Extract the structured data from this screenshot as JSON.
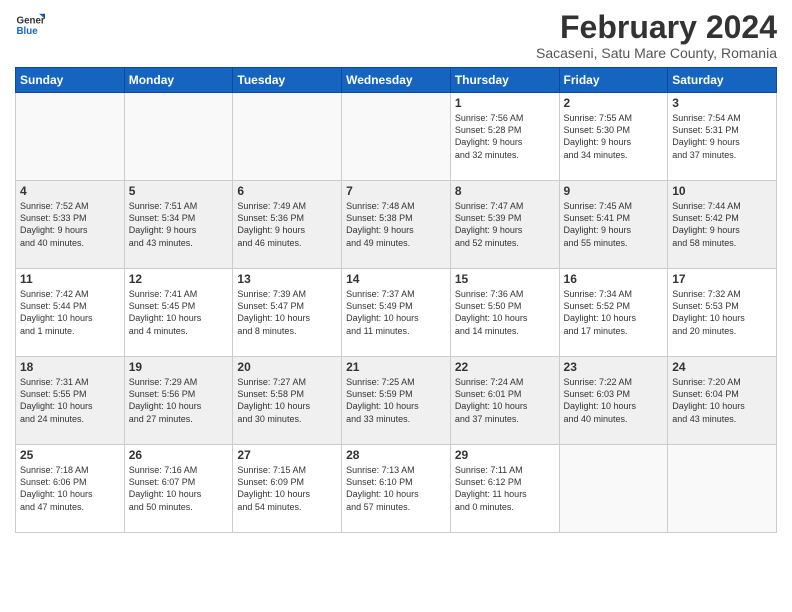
{
  "header": {
    "logo_general": "General",
    "logo_blue": "Blue",
    "month_title": "February 2024",
    "subtitle": "Sacaseni, Satu Mare County, Romania"
  },
  "days_of_week": [
    "Sunday",
    "Monday",
    "Tuesday",
    "Wednesday",
    "Thursday",
    "Friday",
    "Saturday"
  ],
  "weeks": [
    {
      "shaded": false,
      "days": [
        {
          "num": "",
          "info": ""
        },
        {
          "num": "",
          "info": ""
        },
        {
          "num": "",
          "info": ""
        },
        {
          "num": "",
          "info": ""
        },
        {
          "num": "1",
          "info": "Sunrise: 7:56 AM\nSunset: 5:28 PM\nDaylight: 9 hours\nand 32 minutes."
        },
        {
          "num": "2",
          "info": "Sunrise: 7:55 AM\nSunset: 5:30 PM\nDaylight: 9 hours\nand 34 minutes."
        },
        {
          "num": "3",
          "info": "Sunrise: 7:54 AM\nSunset: 5:31 PM\nDaylight: 9 hours\nand 37 minutes."
        }
      ]
    },
    {
      "shaded": true,
      "days": [
        {
          "num": "4",
          "info": "Sunrise: 7:52 AM\nSunset: 5:33 PM\nDaylight: 9 hours\nand 40 minutes."
        },
        {
          "num": "5",
          "info": "Sunrise: 7:51 AM\nSunset: 5:34 PM\nDaylight: 9 hours\nand 43 minutes."
        },
        {
          "num": "6",
          "info": "Sunrise: 7:49 AM\nSunset: 5:36 PM\nDaylight: 9 hours\nand 46 minutes."
        },
        {
          "num": "7",
          "info": "Sunrise: 7:48 AM\nSunset: 5:38 PM\nDaylight: 9 hours\nand 49 minutes."
        },
        {
          "num": "8",
          "info": "Sunrise: 7:47 AM\nSunset: 5:39 PM\nDaylight: 9 hours\nand 52 minutes."
        },
        {
          "num": "9",
          "info": "Sunrise: 7:45 AM\nSunset: 5:41 PM\nDaylight: 9 hours\nand 55 minutes."
        },
        {
          "num": "10",
          "info": "Sunrise: 7:44 AM\nSunset: 5:42 PM\nDaylight: 9 hours\nand 58 minutes."
        }
      ]
    },
    {
      "shaded": false,
      "days": [
        {
          "num": "11",
          "info": "Sunrise: 7:42 AM\nSunset: 5:44 PM\nDaylight: 10 hours\nand 1 minute."
        },
        {
          "num": "12",
          "info": "Sunrise: 7:41 AM\nSunset: 5:45 PM\nDaylight: 10 hours\nand 4 minutes."
        },
        {
          "num": "13",
          "info": "Sunrise: 7:39 AM\nSunset: 5:47 PM\nDaylight: 10 hours\nand 8 minutes."
        },
        {
          "num": "14",
          "info": "Sunrise: 7:37 AM\nSunset: 5:49 PM\nDaylight: 10 hours\nand 11 minutes."
        },
        {
          "num": "15",
          "info": "Sunrise: 7:36 AM\nSunset: 5:50 PM\nDaylight: 10 hours\nand 14 minutes."
        },
        {
          "num": "16",
          "info": "Sunrise: 7:34 AM\nSunset: 5:52 PM\nDaylight: 10 hours\nand 17 minutes."
        },
        {
          "num": "17",
          "info": "Sunrise: 7:32 AM\nSunset: 5:53 PM\nDaylight: 10 hours\nand 20 minutes."
        }
      ]
    },
    {
      "shaded": true,
      "days": [
        {
          "num": "18",
          "info": "Sunrise: 7:31 AM\nSunset: 5:55 PM\nDaylight: 10 hours\nand 24 minutes."
        },
        {
          "num": "19",
          "info": "Sunrise: 7:29 AM\nSunset: 5:56 PM\nDaylight: 10 hours\nand 27 minutes."
        },
        {
          "num": "20",
          "info": "Sunrise: 7:27 AM\nSunset: 5:58 PM\nDaylight: 10 hours\nand 30 minutes."
        },
        {
          "num": "21",
          "info": "Sunrise: 7:25 AM\nSunset: 5:59 PM\nDaylight: 10 hours\nand 33 minutes."
        },
        {
          "num": "22",
          "info": "Sunrise: 7:24 AM\nSunset: 6:01 PM\nDaylight: 10 hours\nand 37 minutes."
        },
        {
          "num": "23",
          "info": "Sunrise: 7:22 AM\nSunset: 6:03 PM\nDaylight: 10 hours\nand 40 minutes."
        },
        {
          "num": "24",
          "info": "Sunrise: 7:20 AM\nSunset: 6:04 PM\nDaylight: 10 hours\nand 43 minutes."
        }
      ]
    },
    {
      "shaded": false,
      "days": [
        {
          "num": "25",
          "info": "Sunrise: 7:18 AM\nSunset: 6:06 PM\nDaylight: 10 hours\nand 47 minutes."
        },
        {
          "num": "26",
          "info": "Sunrise: 7:16 AM\nSunset: 6:07 PM\nDaylight: 10 hours\nand 50 minutes."
        },
        {
          "num": "27",
          "info": "Sunrise: 7:15 AM\nSunset: 6:09 PM\nDaylight: 10 hours\nand 54 minutes."
        },
        {
          "num": "28",
          "info": "Sunrise: 7:13 AM\nSunset: 6:10 PM\nDaylight: 10 hours\nand 57 minutes."
        },
        {
          "num": "29",
          "info": "Sunrise: 7:11 AM\nSunset: 6:12 PM\nDaylight: 11 hours\nand 0 minutes."
        },
        {
          "num": "",
          "info": ""
        },
        {
          "num": "",
          "info": ""
        }
      ]
    }
  ]
}
